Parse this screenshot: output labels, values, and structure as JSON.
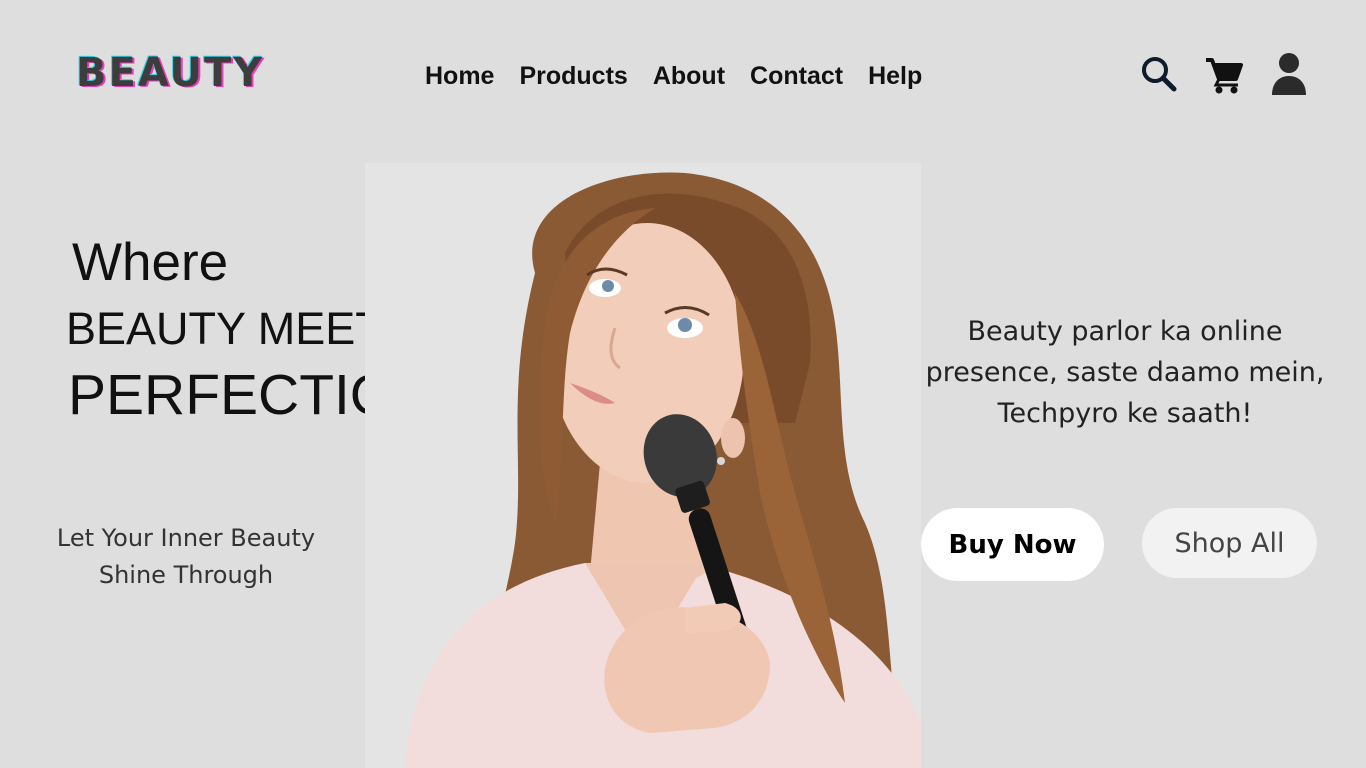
{
  "brand": {
    "logo_text": "BEAUTY"
  },
  "nav": {
    "items": [
      {
        "label": "Home"
      },
      {
        "label": "Products"
      },
      {
        "label": "About"
      },
      {
        "label": "Contact"
      },
      {
        "label": "Help"
      }
    ]
  },
  "header_icons": [
    "search-icon",
    "cart-icon",
    "user-icon"
  ],
  "hero": {
    "heading_line1": "Where",
    "heading_line2": "BEAUTY MEETS",
    "heading_line3": "PERFECTION",
    "tagline": "Let Your Inner Beauty Shine Through",
    "blurb": "Beauty parlor ka online presence, saste daamo mein, Techpyro ke saath!",
    "primary_button": "Buy Now",
    "secondary_button": "Shop All"
  },
  "colors": {
    "background": "#dedede",
    "logo_text": "#3d3d3d",
    "logo_cyan_shadow": "#37d0e6",
    "logo_pink_shadow": "#e63fb8",
    "icon_dark": "#0d1b2a",
    "button_primary_bg": "#ffffff",
    "button_secondary_bg": "#f2f2f2"
  }
}
